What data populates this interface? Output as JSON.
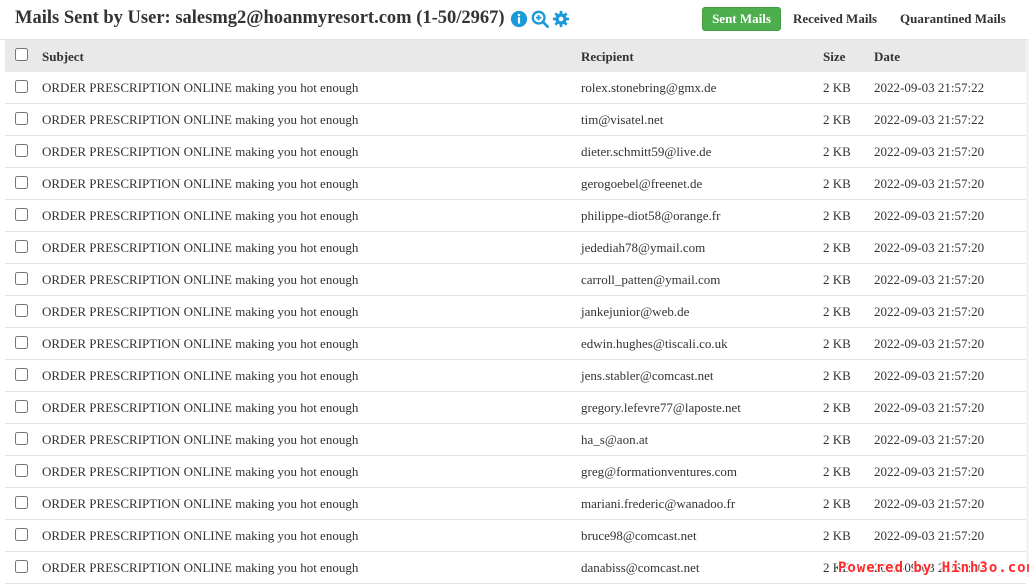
{
  "header": {
    "title": "Mails Sent by User: salesmg2@hoanmyresort.com (1-50/2967)",
    "icons": [
      "info-icon",
      "zoom-in-icon",
      "gear-icon"
    ],
    "tabs": {
      "sent": "Sent Mails",
      "received": "Received Mails",
      "quarantined": "Quarantined Mails"
    }
  },
  "colors": {
    "accent": "#4cae4c",
    "icon": "#1a9bd7"
  },
  "table": {
    "columns": {
      "subject": "Subject",
      "recipient": "Recipient",
      "size": "Size",
      "date": "Date"
    },
    "rows": [
      {
        "subject": "ORDER PRESCRIPTION ONLINE making you hot enough",
        "recipient": "rolex.stonebring@gmx.de",
        "size": "2 KB",
        "date": "2022-09-03 21:57:22"
      },
      {
        "subject": "ORDER PRESCRIPTION ONLINE making you hot enough",
        "recipient": "tim@visatel.net",
        "size": "2 KB",
        "date": "2022-09-03 21:57:22"
      },
      {
        "subject": "ORDER PRESCRIPTION ONLINE making you hot enough",
        "recipient": "dieter.schmitt59@live.de",
        "size": "2 KB",
        "date": "2022-09-03 21:57:20"
      },
      {
        "subject": "ORDER PRESCRIPTION ONLINE making you hot enough",
        "recipient": "gerogoebel@freenet.de",
        "size": "2 KB",
        "date": "2022-09-03 21:57:20"
      },
      {
        "subject": "ORDER PRESCRIPTION ONLINE making you hot enough",
        "recipient": "philippe-diot58@orange.fr",
        "size": "2 KB",
        "date": "2022-09-03 21:57:20"
      },
      {
        "subject": "ORDER PRESCRIPTION ONLINE making you hot enough",
        "recipient": "jedediah78@ymail.com",
        "size": "2 KB",
        "date": "2022-09-03 21:57:20"
      },
      {
        "subject": "ORDER PRESCRIPTION ONLINE making you hot enough",
        "recipient": "carroll_patten@ymail.com",
        "size": "2 KB",
        "date": "2022-09-03 21:57:20"
      },
      {
        "subject": "ORDER PRESCRIPTION ONLINE making you hot enough",
        "recipient": "jankejunior@web.de",
        "size": "2 KB",
        "date": "2022-09-03 21:57:20"
      },
      {
        "subject": "ORDER PRESCRIPTION ONLINE making you hot enough",
        "recipient": "edwin.hughes@tiscali.co.uk",
        "size": "2 KB",
        "date": "2022-09-03 21:57:20"
      },
      {
        "subject": "ORDER PRESCRIPTION ONLINE making you hot enough",
        "recipient": "jens.stabler@comcast.net",
        "size": "2 KB",
        "date": "2022-09-03 21:57:20"
      },
      {
        "subject": "ORDER PRESCRIPTION ONLINE making you hot enough",
        "recipient": "gregory.lefevre77@laposte.net",
        "size": "2 KB",
        "date": "2022-09-03 21:57:20"
      },
      {
        "subject": "ORDER PRESCRIPTION ONLINE making you hot enough",
        "recipient": "ha_s@aon.at",
        "size": "2 KB",
        "date": "2022-09-03 21:57:20"
      },
      {
        "subject": "ORDER PRESCRIPTION ONLINE making you hot enough",
        "recipient": "greg@formationventures.com",
        "size": "2 KB",
        "date": "2022-09-03 21:57:20"
      },
      {
        "subject": "ORDER PRESCRIPTION ONLINE making you hot enough",
        "recipient": "mariani.frederic@wanadoo.fr",
        "size": "2 KB",
        "date": "2022-09-03 21:57:20"
      },
      {
        "subject": "ORDER PRESCRIPTION ONLINE making you hot enough",
        "recipient": "bruce98@comcast.net",
        "size": "2 KB",
        "date": "2022-09-03 21:57:20"
      },
      {
        "subject": "ORDER PRESCRIPTION ONLINE making you hot enough",
        "recipient": "danabiss@comcast.net",
        "size": "2 KB",
        "date": "2022-09-03 21:57:20"
      }
    ]
  },
  "watermark": "Powered by Hinh3o.com"
}
